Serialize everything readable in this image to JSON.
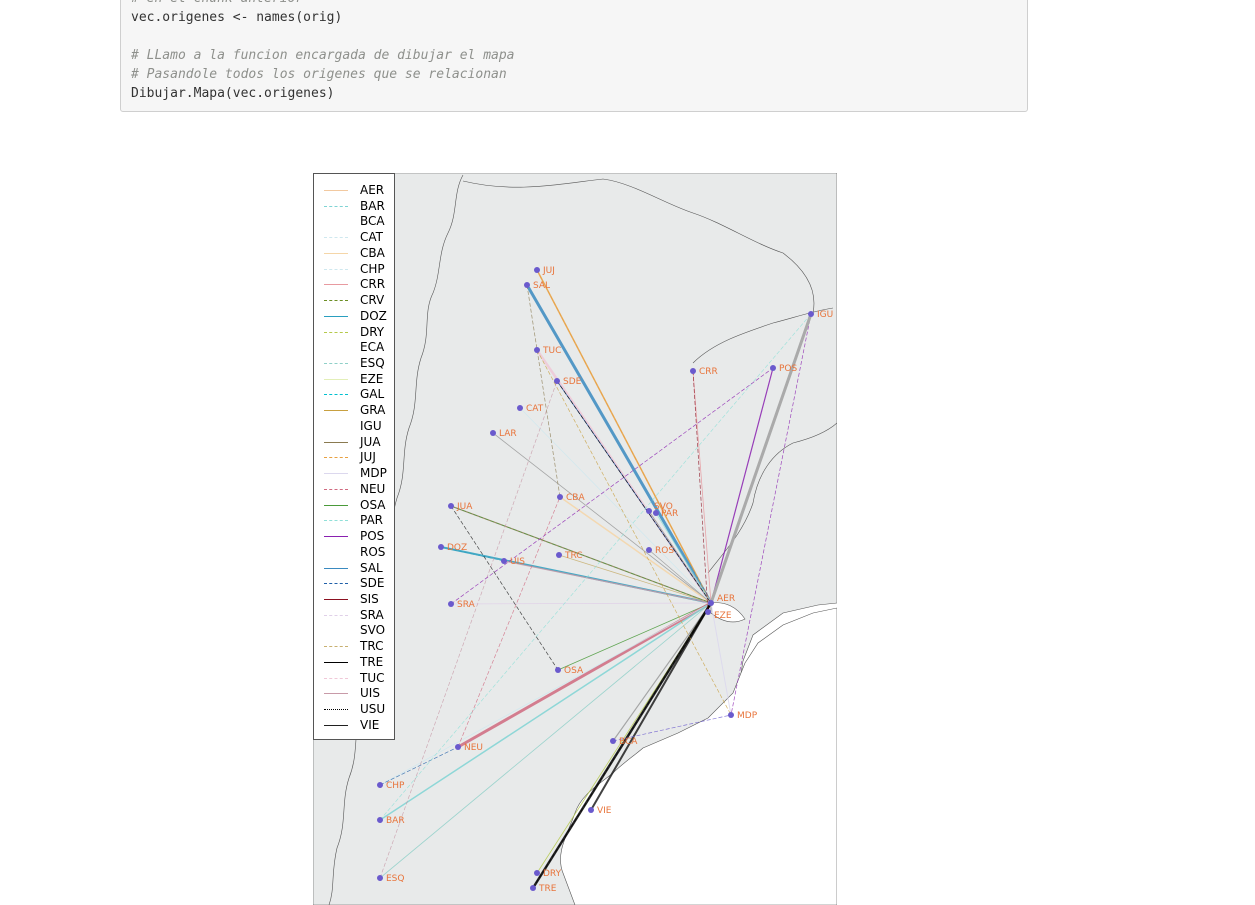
{
  "code": {
    "lines": [
      {
        "text": "# en el chunk anterior",
        "comment": true
      },
      {
        "text": "vec.origenes <- names(orig)",
        "comment": false
      },
      {
        "text": "",
        "comment": false
      },
      {
        "text": "# LLamo a la funcion encargada de dibujar el mapa",
        "comment": true
      },
      {
        "text": "# Pasandole todos los origenes que se relacionan",
        "comment": true
      },
      {
        "text": "Dibujar.Mapa(vec.origenes)",
        "comment": false
      }
    ]
  },
  "map": {
    "legend": [
      {
        "code": "AER",
        "color": "#f2c9a0",
        "dash": "solid"
      },
      {
        "code": "BAR",
        "color": "#7fd4d4",
        "dash": "dashed"
      },
      {
        "code": "BCA",
        "color": "#ffffff",
        "dash": "solid"
      },
      {
        "code": "CAT",
        "color": "#cfe8ef",
        "dash": "dashed"
      },
      {
        "code": "CBA",
        "color": "#f5d6a8",
        "dash": "solid"
      },
      {
        "code": "CHP",
        "color": "#cfe8ef",
        "dash": "dashed"
      },
      {
        "code": "CRR",
        "color": "#e89aa0",
        "dash": "solid"
      },
      {
        "code": "CRV",
        "color": "#6b8e23",
        "dash": "dashed"
      },
      {
        "code": "DOZ",
        "color": "#2a9fbf",
        "dash": "solid"
      },
      {
        "code": "DRY",
        "color": "#b5c94a",
        "dash": "dashed"
      },
      {
        "code": "ECA",
        "color": "#ffffff",
        "dash": "solid"
      },
      {
        "code": "ESQ",
        "color": "#8fd0c8",
        "dash": "dashed"
      },
      {
        "code": "EZE",
        "color": "#e3efb8",
        "dash": "solid"
      },
      {
        "code": "GAL",
        "color": "#00c0d0",
        "dash": "dashed"
      },
      {
        "code": "GRA",
        "color": "#c8a040",
        "dash": "solid"
      },
      {
        "code": "IGU",
        "color": "#ffffff",
        "dash": "solid"
      },
      {
        "code": "JUA",
        "color": "#8a7a50",
        "dash": "solid"
      },
      {
        "code": "JUJ",
        "color": "#e8a040",
        "dash": "dashed"
      },
      {
        "code": "MDP",
        "color": "#dcd8ee",
        "dash": "solid"
      },
      {
        "code": "NEU",
        "color": "#d06a80",
        "dash": "dashed"
      },
      {
        "code": "OSA",
        "color": "#4a9a3a",
        "dash": "solid"
      },
      {
        "code": "PAR",
        "color": "#90e0d8",
        "dash": "dashed"
      },
      {
        "code": "POS",
        "color": "#8a20b0",
        "dash": "solid"
      },
      {
        "code": "ROS",
        "color": "#ffffff",
        "dash": "solid"
      },
      {
        "code": "SAL",
        "color": "#3a8ac0",
        "dash": "solid"
      },
      {
        "code": "SDE",
        "color": "#1f5fa8",
        "dash": "dashed"
      },
      {
        "code": "SIS",
        "color": "#8b1020",
        "dash": "solid"
      },
      {
        "code": "SRA",
        "color": "#e0d0e8",
        "dash": "dashed"
      },
      {
        "code": "SVO",
        "color": "#ffffff",
        "dash": "solid"
      },
      {
        "code": "TRC",
        "color": "#c8b070",
        "dash": "dashed"
      },
      {
        "code": "TRE",
        "color": "#000000",
        "dash": "solid"
      },
      {
        "code": "TUC",
        "color": "#f0c8d8",
        "dash": "dashed"
      },
      {
        "code": "UIS",
        "color": "#c89aa8",
        "dash": "solid"
      },
      {
        "code": "USU",
        "color": "#000000",
        "dash": "dotted"
      },
      {
        "code": "VIE",
        "color": "#202020",
        "dash": "solid"
      }
    ],
    "cities": [
      {
        "code": "JUJ"
      },
      {
        "code": "SAL"
      },
      {
        "code": "IGU"
      },
      {
        "code": "TUC"
      },
      {
        "code": "CRR"
      },
      {
        "code": "POS"
      },
      {
        "code": "SDE"
      },
      {
        "code": "CAT"
      },
      {
        "code": "LAR"
      },
      {
        "code": "CBA"
      },
      {
        "code": "JUA"
      },
      {
        "code": "SVO"
      },
      {
        "code": "PAR"
      },
      {
        "code": "DOZ"
      },
      {
        "code": "TRC"
      },
      {
        "code": "ROS"
      },
      {
        "code": "UIS"
      },
      {
        "code": "AER"
      },
      {
        "code": "EZE"
      },
      {
        "code": "SRA"
      },
      {
        "code": "OSA"
      },
      {
        "code": "MDP"
      },
      {
        "code": "NEU"
      },
      {
        "code": "BCA"
      },
      {
        "code": "CHP"
      },
      {
        "code": "VIE"
      },
      {
        "code": "BAR"
      },
      {
        "code": "DRY"
      },
      {
        "code": "ESQ"
      },
      {
        "code": "TRE"
      }
    ],
    "colors": {
      "land": "#e8eaea",
      "border": "#555555",
      "point": "#6a5acd",
      "label": "#e8743b"
    }
  }
}
